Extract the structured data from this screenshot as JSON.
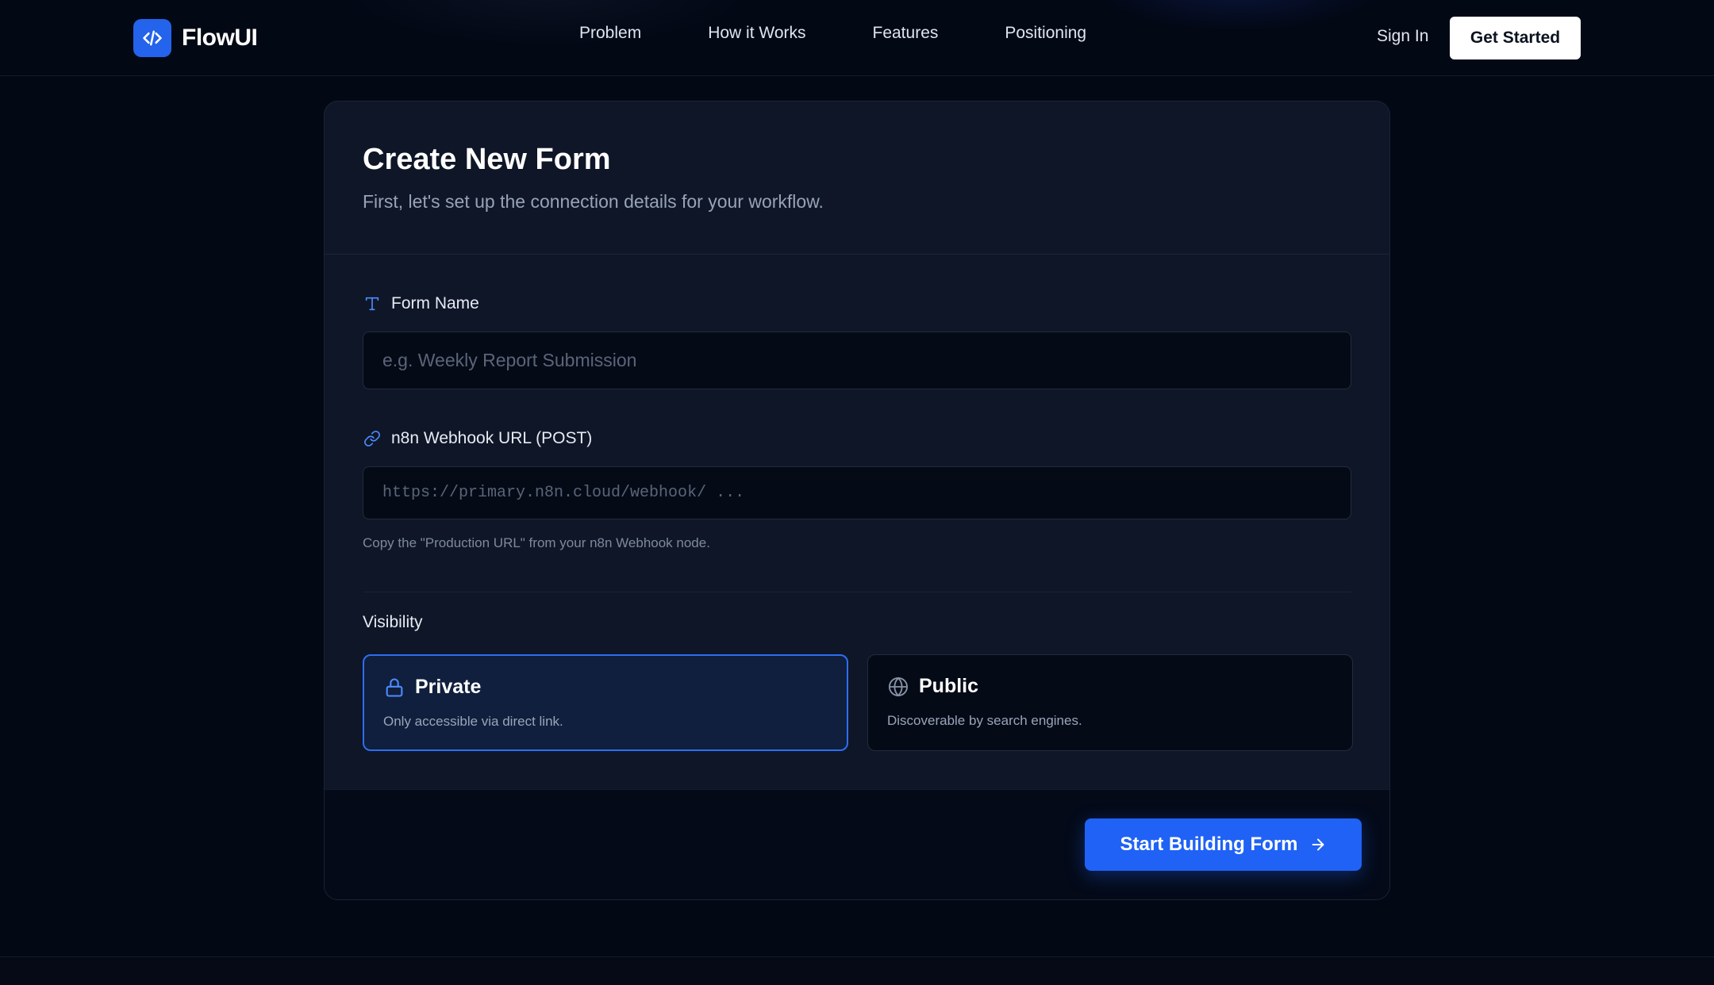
{
  "header": {
    "brand": "FlowUI",
    "nav": [
      "Problem",
      "How it Works",
      "Features",
      "Positioning"
    ],
    "sign_in": "Sign In",
    "get_started": "Get Started"
  },
  "form": {
    "title": "Create New Form",
    "subtitle": "First, let's set up the connection details for your workflow.",
    "name_label": "Form Name",
    "name_placeholder": "e.g. Weekly Report Submission",
    "webhook_label": "n8n Webhook URL (POST)",
    "webhook_placeholder": "https://primary.n8n.cloud/webhook/ ...",
    "webhook_help": "Copy the \"Production URL\" from your n8n Webhook node.",
    "visibility_label": "Visibility",
    "options": [
      {
        "title": "Private",
        "description": "Only accessible via direct link.",
        "selected": true
      },
      {
        "title": "Public",
        "description": "Discoverable by search engines.",
        "selected": false
      }
    ],
    "submit": "Start Building Form"
  },
  "colors": {
    "background": "#030815",
    "accent": "#2463eb",
    "card": "#0f1627"
  },
  "icons": {
    "brand": "code-icon",
    "name_field": "text-type-icon",
    "webhook_field": "link-icon",
    "private": "lock-icon",
    "public": "globe-icon",
    "submit": "arrow-right-icon"
  }
}
